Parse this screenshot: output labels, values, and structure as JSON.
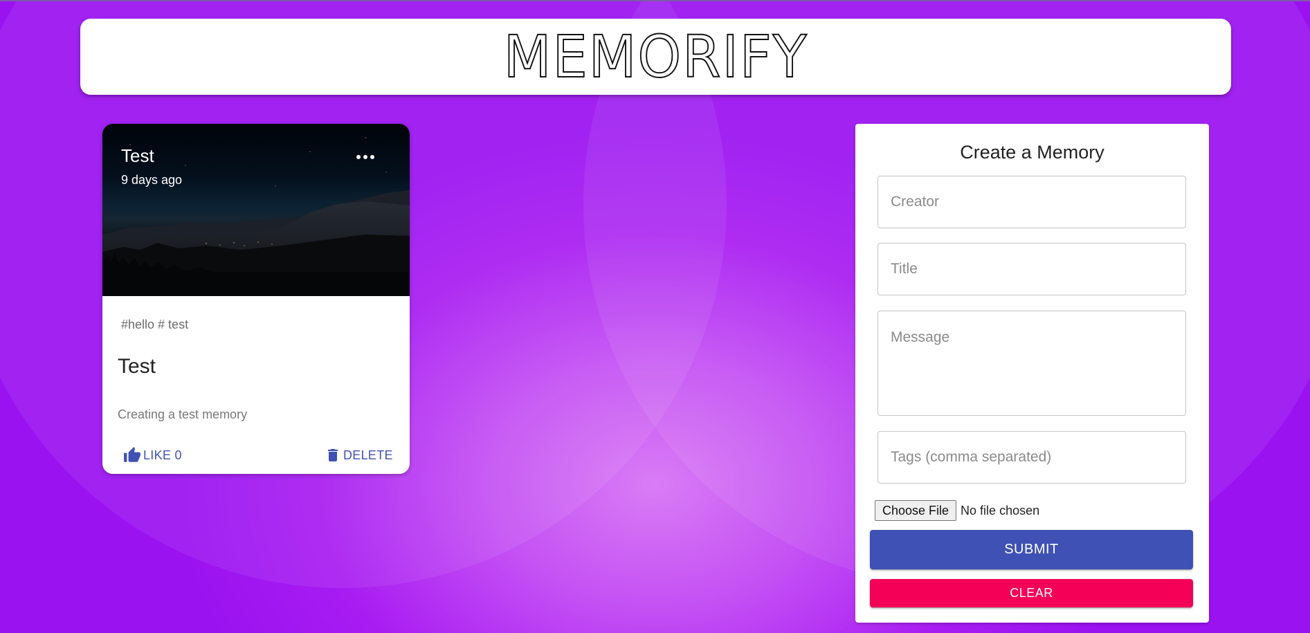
{
  "app": {
    "logo": "MEMORIFY"
  },
  "posts": [
    {
      "title": "Test",
      "time_ago": "9 days ago",
      "tags": "#hello # test",
      "body_title": "Test",
      "message": "Creating a test memory",
      "like_label": "LIKE 0",
      "delete_label": "DELETE",
      "more_icon": "more-horizontal-icon",
      "like_icon": "thumb-up-icon",
      "delete_icon": "trash-icon"
    }
  ],
  "form": {
    "title": "Create a Memory",
    "creator_placeholder": "Creator",
    "title_placeholder": "Title",
    "message_placeholder": "Message",
    "tags_placeholder": "Tags (comma separated)",
    "choose_file_label": "Choose File",
    "file_status": "No file chosen",
    "submit_label": "SUBMIT",
    "clear_label": "CLEAR"
  },
  "colors": {
    "background": "#a81cf2",
    "primary": "#3f51b5",
    "secondary": "#f50057"
  }
}
